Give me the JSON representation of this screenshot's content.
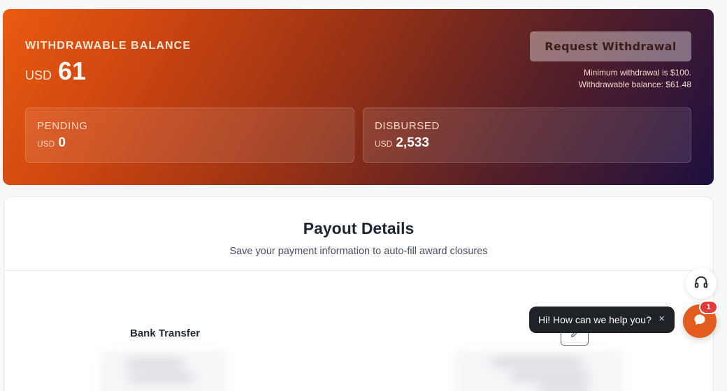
{
  "balance": {
    "label": "WITHDRAWABLE BALANCE",
    "currency": "USD",
    "amount": "61",
    "request_button": "Request Withdrawal",
    "min_note": "Minimum withdrawal is $100.",
    "withdrawable_note": "Withdrawable balance: $61.48",
    "pending": {
      "label": "PENDING",
      "currency": "USD",
      "amount": "0"
    },
    "disbursed": {
      "label": "DISBURSED",
      "currency": "USD",
      "amount": "2,533"
    }
  },
  "payout": {
    "title": "Payout Details",
    "subtitle": "Save your payment information to auto-fill award closures",
    "method_label": "Bank Transfer",
    "edit_icon": "pencil-icon"
  },
  "help": {
    "support_icon": "headset-icon",
    "chat_message": "Hi! How can we help you?",
    "close_glyph": "×",
    "chat_icon": "chat-bubble-icon",
    "badge_count": "1"
  },
  "colors": {
    "accent": "#e45b1e",
    "badge": "#e23b3b",
    "gradient_start": "#ea5a10",
    "gradient_end": "#1e1040"
  }
}
